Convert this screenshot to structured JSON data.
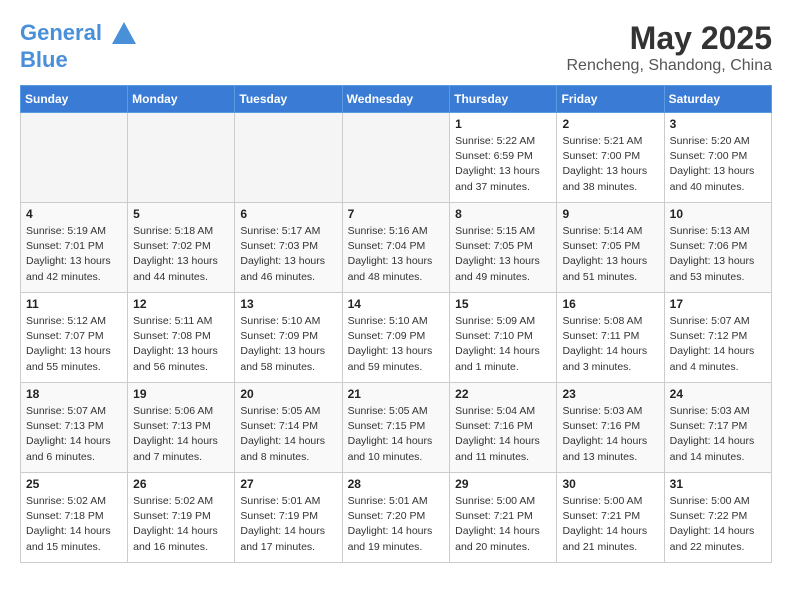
{
  "header": {
    "logo_line1": "General",
    "logo_line2": "Blue",
    "month_year": "May 2025",
    "location": "Rencheng, Shandong, China"
  },
  "weekdays": [
    "Sunday",
    "Monday",
    "Tuesday",
    "Wednesday",
    "Thursday",
    "Friday",
    "Saturday"
  ],
  "weeks": [
    [
      {
        "day": "",
        "info": ""
      },
      {
        "day": "",
        "info": ""
      },
      {
        "day": "",
        "info": ""
      },
      {
        "day": "",
        "info": ""
      },
      {
        "day": "1",
        "info": "Sunrise: 5:22 AM\nSunset: 6:59 PM\nDaylight: 13 hours\nand 37 minutes."
      },
      {
        "day": "2",
        "info": "Sunrise: 5:21 AM\nSunset: 7:00 PM\nDaylight: 13 hours\nand 38 minutes."
      },
      {
        "day": "3",
        "info": "Sunrise: 5:20 AM\nSunset: 7:00 PM\nDaylight: 13 hours\nand 40 minutes."
      }
    ],
    [
      {
        "day": "4",
        "info": "Sunrise: 5:19 AM\nSunset: 7:01 PM\nDaylight: 13 hours\nand 42 minutes."
      },
      {
        "day": "5",
        "info": "Sunrise: 5:18 AM\nSunset: 7:02 PM\nDaylight: 13 hours\nand 44 minutes."
      },
      {
        "day": "6",
        "info": "Sunrise: 5:17 AM\nSunset: 7:03 PM\nDaylight: 13 hours\nand 46 minutes."
      },
      {
        "day": "7",
        "info": "Sunrise: 5:16 AM\nSunset: 7:04 PM\nDaylight: 13 hours\nand 48 minutes."
      },
      {
        "day": "8",
        "info": "Sunrise: 5:15 AM\nSunset: 7:05 PM\nDaylight: 13 hours\nand 49 minutes."
      },
      {
        "day": "9",
        "info": "Sunrise: 5:14 AM\nSunset: 7:05 PM\nDaylight: 13 hours\nand 51 minutes."
      },
      {
        "day": "10",
        "info": "Sunrise: 5:13 AM\nSunset: 7:06 PM\nDaylight: 13 hours\nand 53 minutes."
      }
    ],
    [
      {
        "day": "11",
        "info": "Sunrise: 5:12 AM\nSunset: 7:07 PM\nDaylight: 13 hours\nand 55 minutes."
      },
      {
        "day": "12",
        "info": "Sunrise: 5:11 AM\nSunset: 7:08 PM\nDaylight: 13 hours\nand 56 minutes."
      },
      {
        "day": "13",
        "info": "Sunrise: 5:10 AM\nSunset: 7:09 PM\nDaylight: 13 hours\nand 58 minutes."
      },
      {
        "day": "14",
        "info": "Sunrise: 5:10 AM\nSunset: 7:09 PM\nDaylight: 13 hours\nand 59 minutes."
      },
      {
        "day": "15",
        "info": "Sunrise: 5:09 AM\nSunset: 7:10 PM\nDaylight: 14 hours\nand 1 minute."
      },
      {
        "day": "16",
        "info": "Sunrise: 5:08 AM\nSunset: 7:11 PM\nDaylight: 14 hours\nand 3 minutes."
      },
      {
        "day": "17",
        "info": "Sunrise: 5:07 AM\nSunset: 7:12 PM\nDaylight: 14 hours\nand 4 minutes."
      }
    ],
    [
      {
        "day": "18",
        "info": "Sunrise: 5:07 AM\nSunset: 7:13 PM\nDaylight: 14 hours\nand 6 minutes."
      },
      {
        "day": "19",
        "info": "Sunrise: 5:06 AM\nSunset: 7:13 PM\nDaylight: 14 hours\nand 7 minutes."
      },
      {
        "day": "20",
        "info": "Sunrise: 5:05 AM\nSunset: 7:14 PM\nDaylight: 14 hours\nand 8 minutes."
      },
      {
        "day": "21",
        "info": "Sunrise: 5:05 AM\nSunset: 7:15 PM\nDaylight: 14 hours\nand 10 minutes."
      },
      {
        "day": "22",
        "info": "Sunrise: 5:04 AM\nSunset: 7:16 PM\nDaylight: 14 hours\nand 11 minutes."
      },
      {
        "day": "23",
        "info": "Sunrise: 5:03 AM\nSunset: 7:16 PM\nDaylight: 14 hours\nand 13 minutes."
      },
      {
        "day": "24",
        "info": "Sunrise: 5:03 AM\nSunset: 7:17 PM\nDaylight: 14 hours\nand 14 minutes."
      }
    ],
    [
      {
        "day": "25",
        "info": "Sunrise: 5:02 AM\nSunset: 7:18 PM\nDaylight: 14 hours\nand 15 minutes."
      },
      {
        "day": "26",
        "info": "Sunrise: 5:02 AM\nSunset: 7:19 PM\nDaylight: 14 hours\nand 16 minutes."
      },
      {
        "day": "27",
        "info": "Sunrise: 5:01 AM\nSunset: 7:19 PM\nDaylight: 14 hours\nand 17 minutes."
      },
      {
        "day": "28",
        "info": "Sunrise: 5:01 AM\nSunset: 7:20 PM\nDaylight: 14 hours\nand 19 minutes."
      },
      {
        "day": "29",
        "info": "Sunrise: 5:00 AM\nSunset: 7:21 PM\nDaylight: 14 hours\nand 20 minutes."
      },
      {
        "day": "30",
        "info": "Sunrise: 5:00 AM\nSunset: 7:21 PM\nDaylight: 14 hours\nand 21 minutes."
      },
      {
        "day": "31",
        "info": "Sunrise: 5:00 AM\nSunset: 7:22 PM\nDaylight: 14 hours\nand 22 minutes."
      }
    ]
  ]
}
